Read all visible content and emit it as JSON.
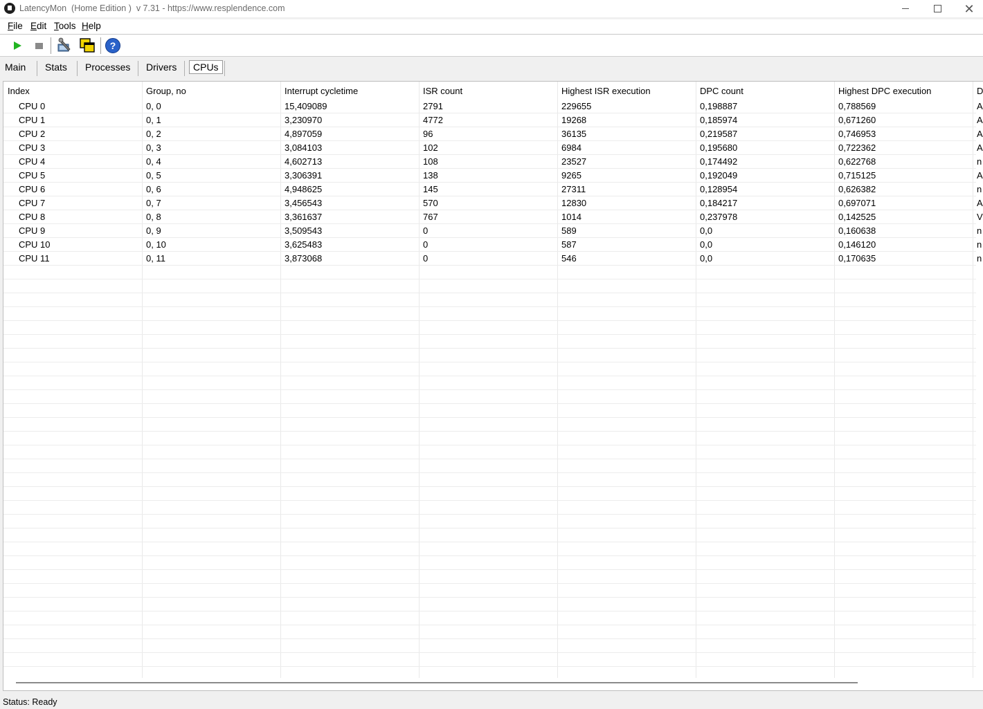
{
  "window": {
    "title": "LatencyMon  (Home Edition )  v 7.31 - https://www.resplendence.com"
  },
  "menu": [
    "File",
    "Edit",
    "Tools",
    "Help"
  ],
  "toolbar": {
    "icons": [
      "play-icon",
      "stop-icon",
      "driver-tools-icon",
      "window-icon",
      "help-icon"
    ],
    "help_glyph": "?"
  },
  "tabs": [
    "Main",
    "Stats",
    "Processes",
    "Drivers",
    "CPUs"
  ],
  "active_tab": "CPUs",
  "table": {
    "columns": [
      "Index",
      "Group, no",
      "Interrupt cycletime",
      "ISR count",
      "Highest ISR execution",
      "DPC count",
      "Highest DPC execution",
      "D"
    ],
    "rows": [
      [
        "CPU 0",
        "0, 0",
        "15,409089",
        "2791",
        "229655",
        "0,198887",
        "0,788569",
        "A"
      ],
      [
        "CPU 1",
        "0, 1",
        "3,230970",
        "4772",
        "19268",
        "0,185974",
        "0,671260",
        "A"
      ],
      [
        "CPU 2",
        "0, 2",
        "4,897059",
        "96",
        "36135",
        "0,219587",
        "0,746953",
        "A"
      ],
      [
        "CPU 3",
        "0, 3",
        "3,084103",
        "102",
        "6984",
        "0,195680",
        "0,722362",
        "A"
      ],
      [
        "CPU 4",
        "0, 4",
        "4,602713",
        "108",
        "23527",
        "0,174492",
        "0,622768",
        "n"
      ],
      [
        "CPU 5",
        "0, 5",
        "3,306391",
        "138",
        "9265",
        "0,192049",
        "0,715125",
        "A"
      ],
      [
        "CPU 6",
        "0, 6",
        "4,948625",
        "145",
        "27311",
        "0,128954",
        "0,626382",
        "n"
      ],
      [
        "CPU 7",
        "0, 7",
        "3,456543",
        "570",
        "12830",
        "0,184217",
        "0,697071",
        "A"
      ],
      [
        "CPU 8",
        "0, 8",
        "3,361637",
        "767",
        "1014",
        "0,237978",
        "0,142525",
        "V"
      ],
      [
        "CPU 9",
        "0, 9",
        "3,509543",
        "0",
        "589",
        "0,0",
        "0,160638",
        "n"
      ],
      [
        "CPU 10",
        "0, 10",
        "3,625483",
        "0",
        "587",
        "0,0",
        "0,146120",
        "n"
      ],
      [
        "CPU 11",
        "0, 11",
        "3,873068",
        "0",
        "546",
        "0,0",
        "0,170635",
        "n"
      ]
    ]
  },
  "status": "Status: Ready"
}
